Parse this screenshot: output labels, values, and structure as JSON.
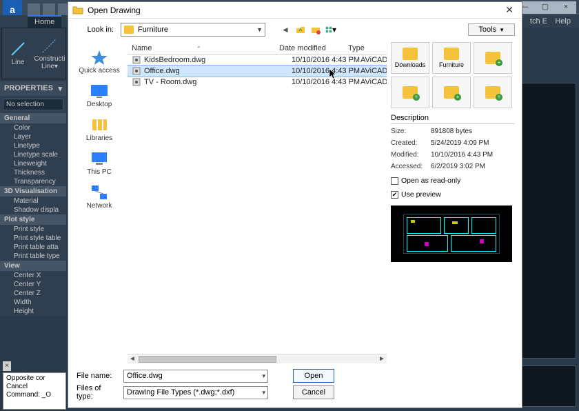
{
  "app": {
    "window_buttons": {
      "min": "—",
      "max": "▢",
      "close": "×"
    },
    "menu": {
      "home": "Home",
      "matchE": "tch E",
      "help": "Help"
    }
  },
  "ribbon": {
    "line": "Line",
    "construction": "Constructi\nLine▾"
  },
  "properties": {
    "title": "PROPERTIES",
    "selection": "No selection",
    "sections": {
      "general": "General",
      "general_rows": [
        "Color",
        "Layer",
        "Linetype",
        "Linetype scale",
        "Lineweight",
        "Thickness",
        "Transparency"
      ],
      "vis": "3D Visualisation",
      "vis_rows": [
        "Material",
        "Shadow displa"
      ],
      "plot": "Plot style",
      "plot_rows": [
        "Print style",
        "Print style table",
        "Print table atta",
        "Print table type"
      ],
      "view": "View",
      "view_rows": [
        "Center X",
        "Center Y",
        "Center Z",
        "Width",
        "Height"
      ]
    }
  },
  "cmdline": {
    "line1": "Opposite cor",
    "line2": "Cancel",
    "line3": "Command: _O"
  },
  "dialog": {
    "title": "Open Drawing",
    "lookin_label": "Look in:",
    "lookin_value": "Furniture",
    "tools": "Tools",
    "places": [
      "Quick access",
      "Desktop",
      "Libraries",
      "This PC",
      "Network"
    ],
    "columns": {
      "name": "Name",
      "date": "Date modified",
      "type": "Type"
    },
    "files": [
      {
        "name": "KidsBedroom.dwg",
        "date": "10/10/2016 4:43 PM",
        "type": "AViCAD DWG"
      },
      {
        "name": "Office.dwg",
        "date": "10/10/2016 4:43 PM",
        "type": "AViCAD DWG"
      },
      {
        "name": "TV - Room.dwg",
        "date": "10/10/2016 4:43 PM",
        "type": "AViCAD DWG"
      }
    ],
    "selected_index": 1,
    "folder_tiles": [
      "Downloads",
      "Furniture",
      "",
      "",
      "",
      ""
    ],
    "description_label": "Description",
    "desc": {
      "size_k": "Size:",
      "size_v": "891808 bytes",
      "created_k": "Created:",
      "created_v": "5/24/2019 4:09 PM",
      "modified_k": "Modified:",
      "modified_v": "10/10/2016 4:43 PM",
      "accessed_k": "Accessed:",
      "accessed_v": "6/2/2019 3:02 PM"
    },
    "chk_readonly": "Open as read-only",
    "chk_preview": "Use preview",
    "filename_label": "File name:",
    "filename_value": "Office.dwg",
    "filetype_label": "Files of type:",
    "filetype_value": "Drawing File Types (*.dwg;*.dxf)",
    "open": "Open",
    "cancel": "Cancel"
  }
}
